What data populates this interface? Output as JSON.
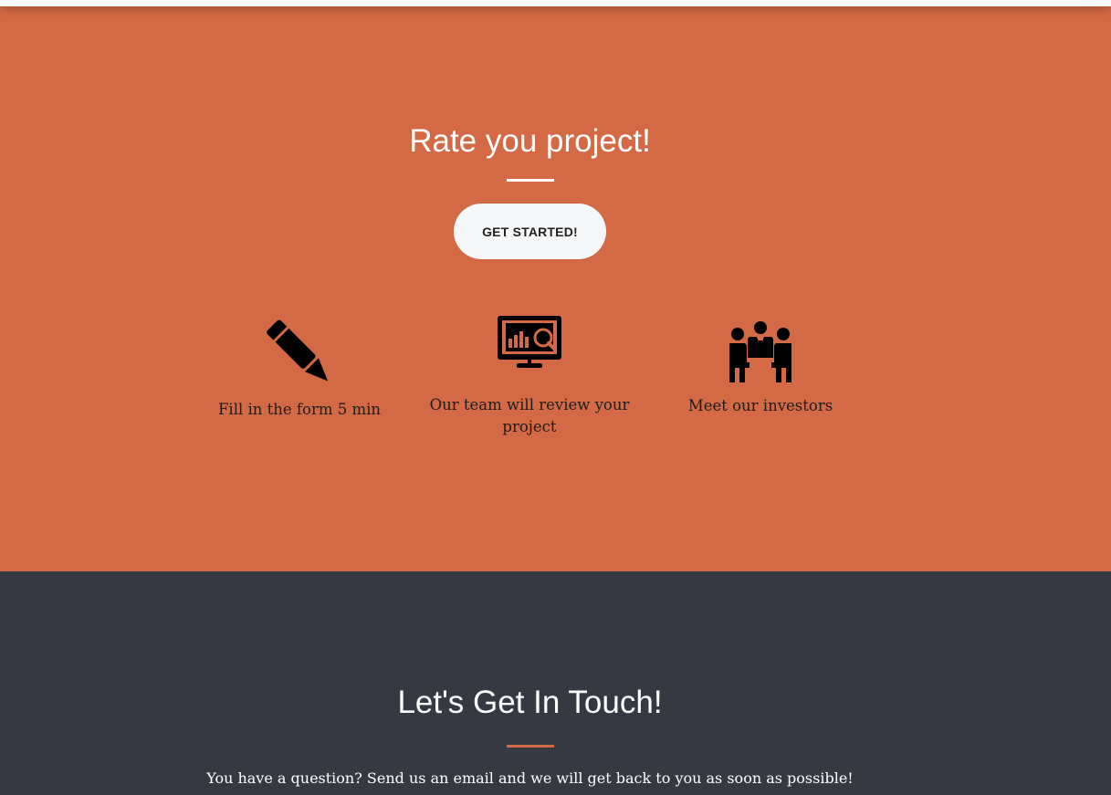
{
  "rate": {
    "title": "Rate you project!",
    "button_label": "GET STARTED!",
    "steps": [
      {
        "icon": "pencil-icon",
        "label": "Fill in the form 5 min"
      },
      {
        "icon": "monitor-analytics-icon",
        "label": "Our team will review your project"
      },
      {
        "icon": "team-meeting-icon",
        "label": "Meet our investors"
      }
    ]
  },
  "contact": {
    "title": "Let's Get In Touch!",
    "text": "You have a question? Send us an email and we will get back to you as soon as possible!"
  },
  "colors": {
    "accent": "#d46a45",
    "dark": "#373942",
    "button_bg": "#f6f7f9"
  }
}
